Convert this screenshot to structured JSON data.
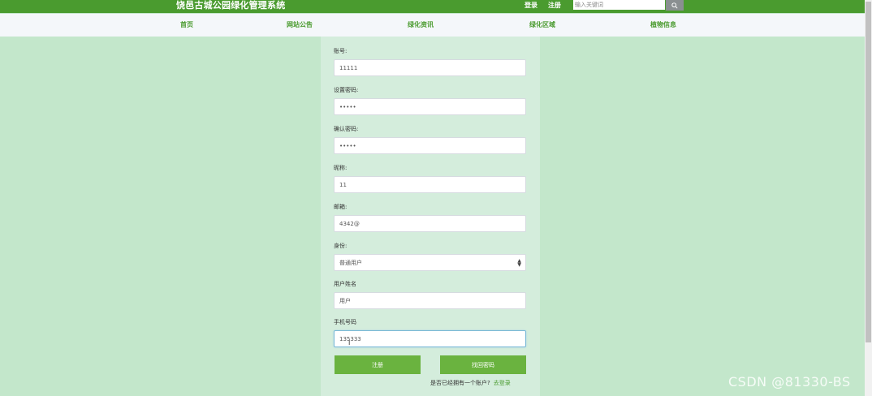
{
  "header": {
    "site_title": "饶邑古城公园绿化管理系统",
    "login_label": "登录",
    "register_label": "注册",
    "search_placeholder": "输入关键词"
  },
  "nav": {
    "items": [
      {
        "label": "首页"
      },
      {
        "label": "网站公告"
      },
      {
        "label": "绿化资讯"
      },
      {
        "label": "绿化区域"
      },
      {
        "label": "植物信息"
      }
    ]
  },
  "form": {
    "fields": [
      {
        "label": "账号:",
        "value": "11111"
      },
      {
        "label": "设置密码:",
        "value": "•••••"
      },
      {
        "label": "确认密码:",
        "value": "•••••"
      },
      {
        "label": "昵称:",
        "value": "11"
      },
      {
        "label": "邮箱:",
        "value": "4342@"
      },
      {
        "label": "身份:",
        "value": "普通用户"
      },
      {
        "label": "用户姓名",
        "value": "用户"
      },
      {
        "label": "手机号码",
        "value": "135333"
      }
    ],
    "register_button": "注册",
    "reset_button": "找回密码",
    "have_account_text": "是否已经拥有一个账户?",
    "login_link": "去登录"
  },
  "watermark": "CSDN @81330-BS",
  "colors": {
    "brand_green": "#4a9b2f",
    "button_green": "#6ab33f",
    "page_bg": "#c3e7cb",
    "panel_bg": "#d4eddc"
  }
}
